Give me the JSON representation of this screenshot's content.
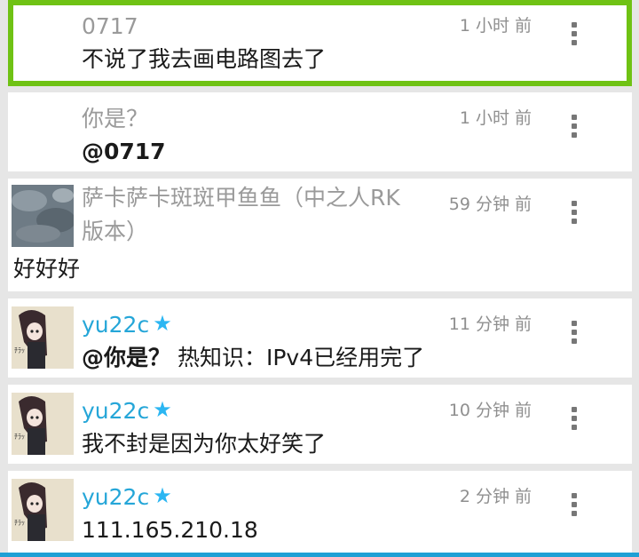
{
  "comments": [
    {
      "name": "0717",
      "time": "1 小时 前",
      "text": "不说了我去画电路图去了"
    },
    {
      "name": "你是？",
      "time": "1 小时 前",
      "text": "@0717"
    },
    {
      "name": "萨卡萨卡斑斑甲鱼鱼（中之人RK版本）",
      "time": "59 分钟 前",
      "text": "好好好"
    },
    {
      "name": "yu22c",
      "time": "11 分钟 前",
      "mention": "@你是？",
      "text": " 热知识：IPv4已经用完了"
    },
    {
      "name": "yu22c",
      "time": "10 分钟 前",
      "text": "我不封是因为你太好笑了"
    },
    {
      "name": "yu22c",
      "time": "2 分钟 前",
      "text": "111.165.210.18"
    }
  ],
  "icons": {
    "star": "star-icon",
    "more": "more-vertical-icon"
  },
  "colors": {
    "highlight": "#6fc214",
    "username": "#25a6d8",
    "star": "#2bb6f2"
  }
}
